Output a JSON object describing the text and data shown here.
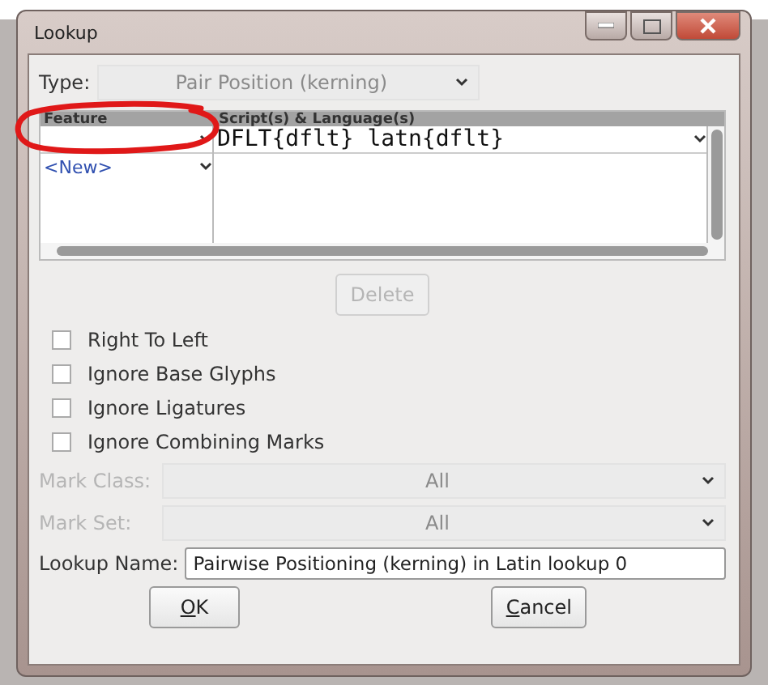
{
  "window": {
    "title": "Lookup"
  },
  "type_field": {
    "label": "Type:",
    "value": "Pair Position (kerning)",
    "disabled": true
  },
  "table": {
    "columns": [
      "Feature",
      "Script(s) & Language(s)"
    ],
    "rows": [
      {
        "kind": "entry",
        "script": "DFLT{dflt} latn{dflt}"
      },
      {
        "kind": "new",
        "feature": "<New>"
      }
    ]
  },
  "delete_button": {
    "label": "Delete",
    "disabled": true
  },
  "options": [
    {
      "label": "Right To Left",
      "checked": false
    },
    {
      "label": "Ignore Base Glyphs",
      "checked": false
    },
    {
      "label": "Ignore Ligatures",
      "checked": false
    },
    {
      "label": "Ignore Combining Marks",
      "checked": false
    }
  ],
  "selects": [
    {
      "label": "Mark Class:",
      "value": "All",
      "disabled": true
    },
    {
      "label": "Mark Set:",
      "value": "All",
      "disabled": true
    }
  ],
  "lookup_name": {
    "label": "Lookup Name:",
    "value": "Pairwise Positioning (kerning) in Latin lookup 0"
  },
  "buttons": [
    {
      "label": "OK",
      "mnemonic_underlined": true
    },
    {
      "label": "Cancel",
      "mnemonic_underlined": true
    }
  ],
  "annotation": {
    "kind": "ellipse"
  }
}
